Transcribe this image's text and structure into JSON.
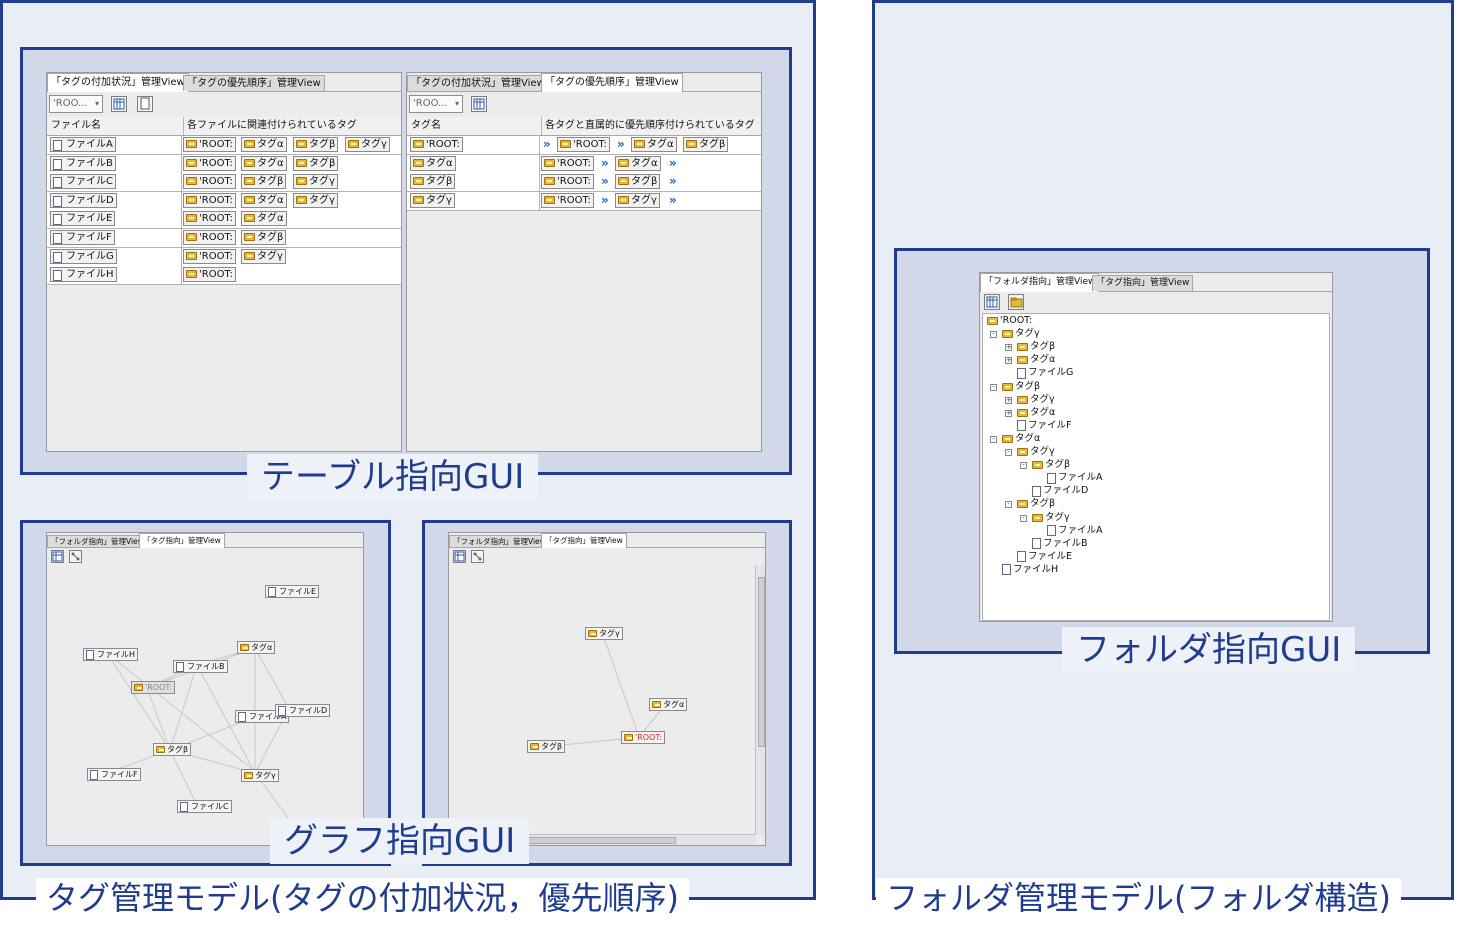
{
  "captions": {
    "table_gui": "テーブル指向GUI",
    "graph_gui": "グラフ指向GUI",
    "folder_gui": "フォルダ指向GUI",
    "tag_model": "タグ管理モデル(タグの付加状況，優先順序)",
    "folder_model": "フォルダ管理モデル(フォルダ構造)"
  },
  "table_left": {
    "tabs": [
      "「タグの付加状況」管理View",
      "「タグの優先順序」管理View"
    ],
    "combo": "'ROO...",
    "columns": [
      "ファイル名",
      "各ファイルに関連付けられているタグ"
    ],
    "rows": [
      {
        "file": "ファイルA",
        "tags": [
          "'ROOT:",
          "タグα",
          "タグβ",
          "タグγ"
        ]
      },
      {
        "file": "ファイルB",
        "tags": [
          "'ROOT:",
          "タグα",
          "タグβ"
        ]
      },
      {
        "file": "ファイルC",
        "tags": [
          "'ROOT:",
          "タグβ",
          "タグγ"
        ]
      },
      {
        "file": "ファイルD",
        "tags": [
          "'ROOT:",
          "タグα",
          "タグγ"
        ]
      },
      {
        "file": "ファイルE",
        "tags": [
          "'ROOT:",
          "タグα"
        ]
      },
      {
        "file": "ファイルF",
        "tags": [
          "'ROOT:",
          "タグβ"
        ]
      },
      {
        "file": "ファイルG",
        "tags": [
          "'ROOT:",
          "タグγ"
        ]
      },
      {
        "file": "ファイルH",
        "tags": [
          "'ROOT:"
        ]
      }
    ]
  },
  "table_right": {
    "tabs": [
      "「タグの付加状況」管理View",
      "「タグの優先順序」管理View"
    ],
    "combo": "'ROO...",
    "columns": [
      "タグ名",
      "各タグと直属的に優先順序付けられているタグ"
    ],
    "rows": [
      {
        "tag": "'ROOT:",
        "chain": [
          "»",
          "'ROOT:",
          "»",
          "タグα",
          "タグβ"
        ]
      },
      {
        "tag": "タグα",
        "chain": [
          "'ROOT:",
          "»",
          "タグα",
          "»"
        ]
      },
      {
        "tag": "タグβ",
        "chain": [
          "'ROOT:",
          "»",
          "タグβ",
          "»"
        ]
      },
      {
        "tag": "タグγ",
        "chain": [
          "'ROOT:",
          "»",
          "タグγ",
          "»"
        ]
      }
    ]
  },
  "graph_left": {
    "tabs": [
      "「フォルダ指向」管理View",
      "「タグ指向」管理View"
    ],
    "nodes": [
      "ファイルE",
      "タグα",
      "ファイルH",
      "ファイルB",
      "'ROOT:",
      "ファイルA",
      "ファイルD",
      "タグβ",
      "ファイルF",
      "タグγ",
      "ファイルC"
    ]
  },
  "graph_right": {
    "tabs": [
      "「フォルダ指向」管理View",
      "「タグ指向」管理View"
    ],
    "nodes": [
      "タグγ",
      "タグα",
      "'ROOT:",
      "タグβ"
    ]
  },
  "folder": {
    "tabs": [
      "「フォルダ指向」管理View",
      "「タグ指向」管理View"
    ],
    "tree": [
      {
        "label": "'ROOT:",
        "depth": 0,
        "kind": "folder",
        "pm": ""
      },
      {
        "label": "タグγ",
        "depth": 1,
        "kind": "folder",
        "pm": "-"
      },
      {
        "label": "タグβ",
        "depth": 2,
        "kind": "folder",
        "pm": "+"
      },
      {
        "label": "タグα",
        "depth": 2,
        "kind": "folder",
        "pm": "+"
      },
      {
        "label": "ファイルG",
        "depth": 2,
        "kind": "file",
        "pm": ""
      },
      {
        "label": "タグβ",
        "depth": 1,
        "kind": "folder",
        "pm": "-"
      },
      {
        "label": "タグγ",
        "depth": 2,
        "kind": "folder",
        "pm": "+"
      },
      {
        "label": "タグα",
        "depth": 2,
        "kind": "folder",
        "pm": "+"
      },
      {
        "label": "ファイルF",
        "depth": 2,
        "kind": "file",
        "pm": ""
      },
      {
        "label": "タグα",
        "depth": 1,
        "kind": "folder",
        "pm": "-"
      },
      {
        "label": "タグγ",
        "depth": 2,
        "kind": "folder",
        "pm": "-"
      },
      {
        "label": "タグβ",
        "depth": 3,
        "kind": "folder",
        "pm": "-"
      },
      {
        "label": "ファイルA",
        "depth": 4,
        "kind": "file",
        "pm": ""
      },
      {
        "label": "ファイルD",
        "depth": 3,
        "kind": "file",
        "pm": ""
      },
      {
        "label": "タグβ",
        "depth": 2,
        "kind": "folder",
        "pm": "-"
      },
      {
        "label": "タグγ",
        "depth": 3,
        "kind": "folder",
        "pm": "-"
      },
      {
        "label": "ファイルA",
        "depth": 4,
        "kind": "file",
        "pm": ""
      },
      {
        "label": "ファイルB",
        "depth": 3,
        "kind": "file",
        "pm": ""
      },
      {
        "label": "ファイルE",
        "depth": 2,
        "kind": "file",
        "pm": ""
      },
      {
        "label": "ファイルH",
        "depth": 1,
        "kind": "file",
        "pm": ""
      }
    ]
  },
  "colors": {
    "frame": "#1f3c8f",
    "outer_fill": "#e8edf6",
    "inner_fill": "#d0d8ea",
    "root_highlight": "#e02020"
  }
}
